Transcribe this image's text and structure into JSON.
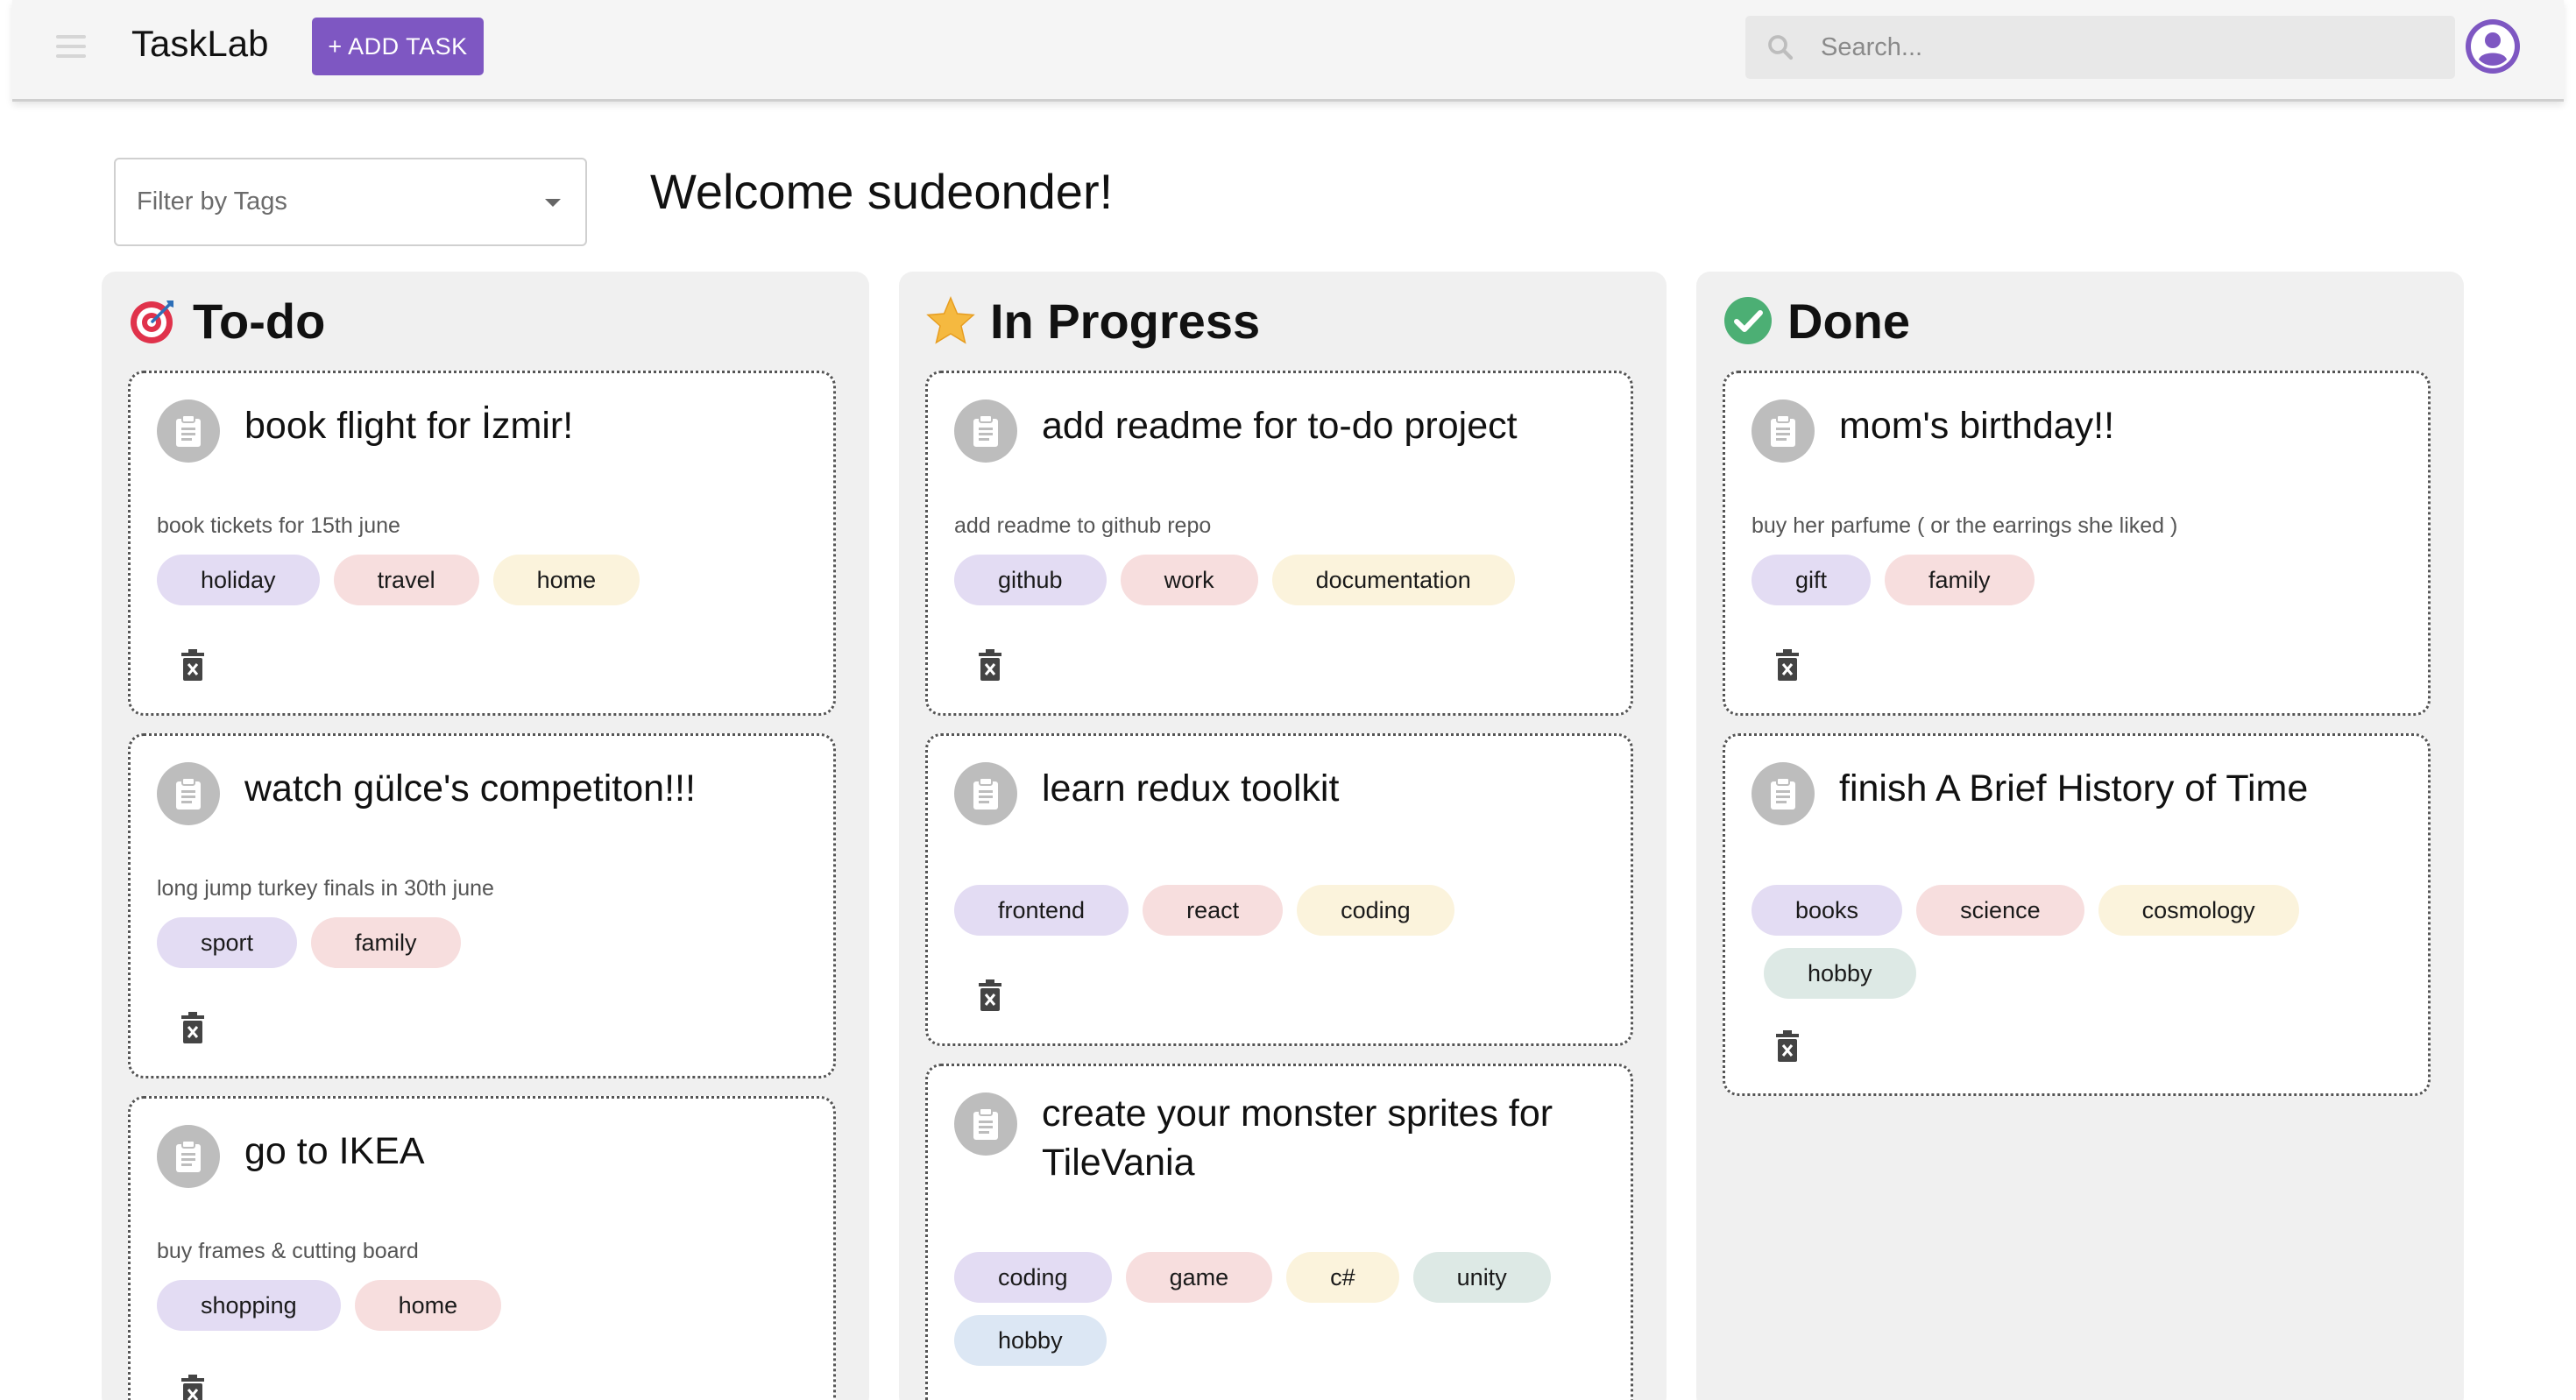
{
  "app": {
    "title": "TaskLab",
    "add_task_label": "+ ADD TASK",
    "search_placeholder": "Search..."
  },
  "filter": {
    "label": "Filter by Tags"
  },
  "welcome": "Welcome sudeonder!",
  "colors": {
    "accent": "#7e57c2",
    "tag_purple": "#e3dcf3",
    "tag_red": "#f7dede",
    "tag_yellow": "#fbf3dc",
    "tag_green": "#dde9e5",
    "tag_blue": "#dce7f4"
  },
  "columns": [
    {
      "title": "To-do",
      "icon": "target-icon",
      "cards": [
        {
          "title": "book flight for İzmir!",
          "description": "book tickets for 15th june",
          "tags": [
            "holiday",
            "travel",
            "home"
          ]
        },
        {
          "title": "watch gülce's competiton!!!",
          "description": "long jump turkey finals in 30th june",
          "tags": [
            "sport",
            "family"
          ]
        },
        {
          "title": "go to IKEA",
          "description": "buy frames & cutting board",
          "tags": [
            "shopping",
            "home"
          ]
        }
      ]
    },
    {
      "title": "In Progress",
      "icon": "star-icon",
      "cards": [
        {
          "title": "add readme for to-do project",
          "description": "add readme to github repo",
          "tags": [
            "github",
            "work",
            "documentation"
          ]
        },
        {
          "title": "learn redux toolkit",
          "description": "",
          "tags": [
            "frontend",
            "react",
            "coding"
          ]
        },
        {
          "title": "create your monster sprites for TileVania",
          "description": "",
          "tags": [
            "coding",
            "game",
            "c#",
            "unity",
            "hobby"
          ]
        }
      ]
    },
    {
      "title": "Done",
      "icon": "check-circle-icon",
      "cards": [
        {
          "title": "mom's birthday!!",
          "description": "buy her parfume ( or the earrings she liked )",
          "tags": [
            "gift",
            "family"
          ]
        },
        {
          "title": "finish A Brief History of Time",
          "description": "",
          "tags": [
            "books",
            "science",
            "cosmology",
            "hobby"
          ]
        }
      ]
    }
  ]
}
